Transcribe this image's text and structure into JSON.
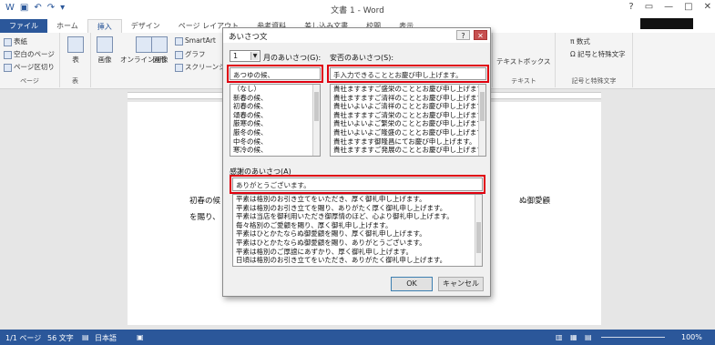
{
  "window": {
    "title": "文書 1 - Word",
    "tabs": [
      "ファイル",
      "ホーム",
      "挿入",
      "デザイン",
      "ページ レイアウト",
      "参考資料",
      "差し込み文書",
      "校閲",
      "表示"
    ],
    "active_tab": "挿入"
  },
  "ribbon": {
    "pages": {
      "items": [
        "表紙",
        "空白のページ",
        "ページ区切り"
      ],
      "label": "ページ"
    },
    "table": {
      "item": "表",
      "label": "表"
    },
    "illustrations": {
      "items": [
        "画像",
        "オンライン画像",
        "図形"
      ],
      "smartart": "SmartArt",
      "chart": "グラフ",
      "screenshot": "スクリーンショ"
    },
    "text": {
      "textbox": "テキストボックス",
      "label": "テキスト"
    },
    "symbols": {
      "equation": "数式",
      "symbol": "記号と特殊文字",
      "label": "記号と特殊文字"
    }
  },
  "document": {
    "line1_left": "初春の候",
    "line1_right": "ぬ御愛顧",
    "line2": "を賜り、"
  },
  "dialog": {
    "title": "あいさつ文",
    "help": "?",
    "close": "✕",
    "month_value": "1",
    "month_label": "月のあいさつ(G):",
    "anpi_label": "安否のあいさつ(S):",
    "month_input": "あつゆの候、",
    "anpi_input": "手入力できることとお慶び申し上げます。",
    "month_list": [
      "（なし）",
      "新春の候、",
      "初春の候、",
      "頌春の候、",
      "厳寒の候、",
      "厳冬の候、",
      "中冬の候、",
      "寒冷の候、"
    ],
    "anpi_list": [
      "貴社ますますご盛栄のこととお慶び申し上げます。",
      "貴社ますますご清祥のこととお慶び申し上げます。",
      "貴社いよいよご清祥のこととお慶び申し上げます。",
      "貴社ますますご清栄のこととお慶び申し上げます。",
      "貴社いよいよご繁栄のこととお慶び申し上げます。",
      "貴社いよいよご隆盛のこととお慶び申し上げます。",
      "貴社ますます御隆昌にてお慶び申し上げます。",
      "貴社ますますご発展のこととお慶び申し上げます。"
    ],
    "thanks_label": "感謝のあいさつ(A)",
    "thanks_input": "ありがとうございます。",
    "thanks_list": [
      "平素は格別のお引き立てをいただき、厚く御礼申し上げます。",
      "平素は格別のお引き立てを賜り、ありがたく厚く御礼申し上げます。",
      "平素は当店を御利用いただき御厚情のほど、心より御礼申し上げます。",
      "毎々格別のご愛顧を賜り、厚く御礼申し上げます。",
      "平素はひとかたならぬ御愛顧を賜り、厚く御礼申し上げます。",
      "平素はひとかたならぬ御愛顧を賜り、ありがとうございます。",
      "平素は格別のご厚誼にあずかり、厚く御礼申し上げます。",
      "日頃は格別のお引き立てをいただき、ありがたく御礼申し上げます。"
    ],
    "ok": "OK",
    "cancel": "キャンセル"
  },
  "status": {
    "page": "1/1 ページ",
    "words": "56 文字",
    "lang": "日本語",
    "zoom": "100%"
  },
  "colors": {
    "accent": "#2b579a",
    "highlight": "#e0000f"
  }
}
